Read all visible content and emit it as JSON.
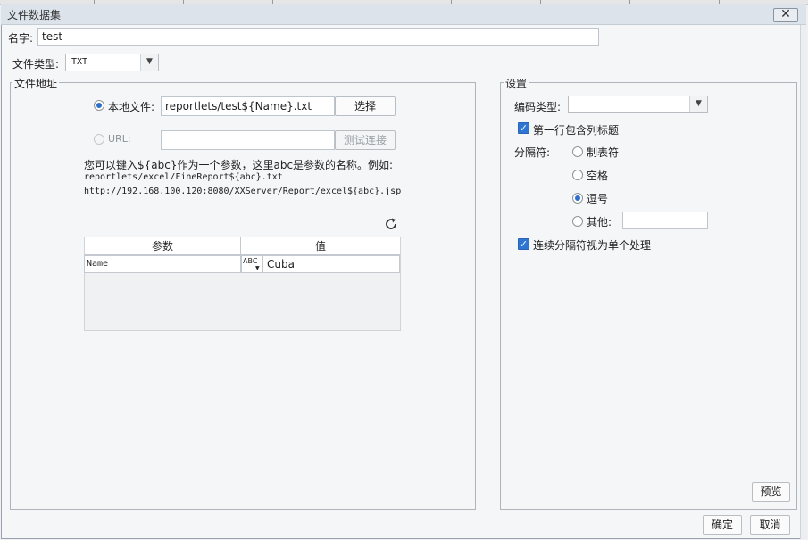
{
  "window": {
    "title": "文件数据集",
    "close_glyph": "✕"
  },
  "name_field": {
    "label": "名字:",
    "value": "test"
  },
  "file_type": {
    "label": "文件类型:",
    "value": "TXT"
  },
  "file_address": {
    "group_title": "文件地址",
    "local_file": {
      "label": "本地文件:",
      "path": "reportlets/test${Name}.txt",
      "button": "选择",
      "selected": true
    },
    "url": {
      "label": "URL:",
      "value": "",
      "button": "测试连接",
      "selected": false
    },
    "hint_line1": "您可以键入${abc}作为一个参数，这里abc是参数的名称。例如:",
    "hint_line2": "reportlets/excel/FineReport${abc}.txt",
    "hint_line3": "http://192.168.100.120:8080/XXServer/Report/excel${abc}.jsp",
    "refresh_icon": "refresh-icon",
    "params_table": {
      "headers": [
        "参数",
        "值"
      ],
      "rows": [
        {
          "param": "Name",
          "type_icon_text": "ABC",
          "value": "Cuba"
        }
      ]
    }
  },
  "settings": {
    "group_title": "设置",
    "encoding": {
      "label": "编码类型:",
      "value": ""
    },
    "first_row_header": {
      "label": "第一行包含列标题",
      "checked": true
    },
    "delimiter": {
      "label": "分隔符:",
      "options": [
        {
          "label": "制表符",
          "checked": false
        },
        {
          "label": "空格",
          "checked": false
        },
        {
          "label": "逗号",
          "checked": true
        },
        {
          "label": "其他:",
          "checked": false
        }
      ],
      "other_value": ""
    },
    "merge_delimiters": {
      "label": "连续分隔符视为单个处理",
      "checked": true
    },
    "preview_button": "预览"
  },
  "footer": {
    "ok": "确定",
    "cancel": "取消"
  },
  "colors": {
    "accent": "#2f76d3",
    "border": "#aeb4bb",
    "background": "#f5f6f8"
  }
}
